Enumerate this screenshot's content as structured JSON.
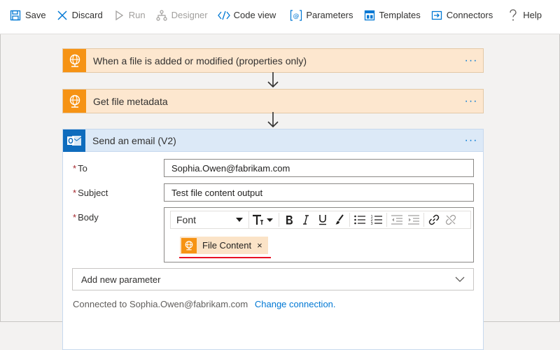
{
  "toolbar": {
    "save": "Save",
    "discard": "Discard",
    "run": "Run",
    "designer": "Designer",
    "code_view": "Code view",
    "parameters": "Parameters",
    "templates": "Templates",
    "connectors": "Connectors",
    "help": "Help"
  },
  "steps": [
    {
      "title": "When a file is added or modified (properties only)",
      "icon": "sftp-globe-icon"
    },
    {
      "title": "Get file metadata",
      "icon": "sftp-globe-icon"
    }
  ],
  "more_label": "···",
  "email": {
    "title": "Send an email (V2)",
    "icon": "outlook-icon",
    "required_mark": "*",
    "to_label": "To",
    "to_value": "Sophia.Owen@fabrikam.com",
    "subject_label": "Subject",
    "subject_value": "Test file content output",
    "body_label": "Body",
    "font_label": "Font",
    "token_label": "File Content",
    "token_remove": "×",
    "add_parameter": "Add new parameter",
    "connected_prefix": "Connected to",
    "connected_email": "Sophia.Owen@fabrikam.com",
    "change_connection": "Change connection."
  },
  "colors": {
    "trigger_accent": "#f69314",
    "trigger_header": "#fde7cf",
    "email_accent": "#0f6cbd",
    "email_header": "#dce9f7",
    "link": "#0078d4",
    "required": "#a4262c",
    "highlight": "#e81123"
  }
}
